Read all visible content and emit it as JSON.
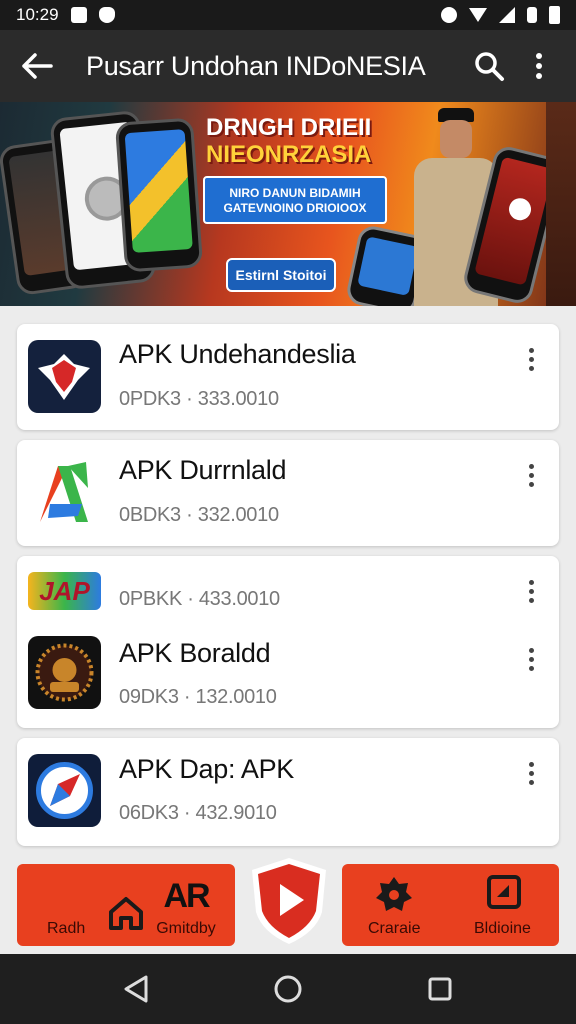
{
  "status_bar": {
    "time": "10:29"
  },
  "app_bar": {
    "title": "Pusarr Undohan INDoNESIA"
  },
  "banner": {
    "headline_1": "DRNGH DRIEII",
    "headline_2": "NIEONRZASIA",
    "subtext_1": "NIRO DANUN BIDAMIH",
    "subtext_2": "GATEVNOINO DRIOIOOX",
    "cta": "Estirnl Stoitoi"
  },
  "apps": [
    {
      "name": "APK Undehandeslia",
      "meta": "0PDK3 · 333.0010",
      "icon": "shield-wings-icon"
    },
    {
      "name": "APK Durrnlald",
      "meta": "0BDK3 · 332.0010",
      "icon": "colorful-a-icon"
    },
    {
      "name": "",
      "meta": "0PBKK · 433.0010",
      "icon": "jap-logo-icon"
    },
    {
      "name": "APK Boraldd",
      "meta": "09DK3 · 132.0010",
      "icon": "emblem-icon"
    },
    {
      "name": "APK Dap: APK",
      "meta": "06DK3 · 432.9010",
      "icon": "compass-icon"
    }
  ],
  "bottom_tabs": {
    "tab1": "Radh",
    "tab2": "Gmitdby",
    "tab3": "Craraie",
    "tab4": "Bldioine",
    "tab2_badge": "AR"
  },
  "colors": {
    "accent": "#e8401f",
    "app_bar": "#2b2b2b",
    "banner_yellow": "#ffd23a"
  }
}
